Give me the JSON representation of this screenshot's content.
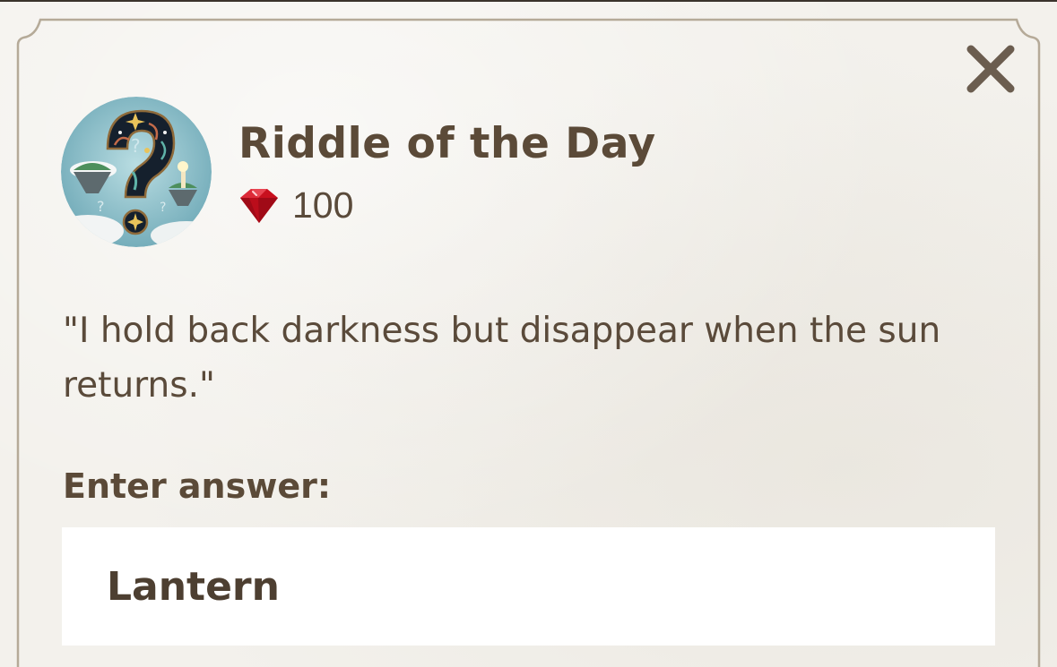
{
  "dialog": {
    "title": "Riddle of the Day",
    "avatar_icon": "riddle-question-mark-icon",
    "close_icon": "close-icon",
    "reward": {
      "icon": "ruby-gem-icon",
      "amount": "100"
    },
    "riddle": "\"I hold back darkness but disappear when the sun returns.\"",
    "answer_label": "Enter answer:",
    "answer_value": "Lantern"
  },
  "colors": {
    "background": "#f3f1ec",
    "frame_border": "#b5aa98",
    "text": "#5a4a3a",
    "close_icon": "#6b5d4f",
    "gem": "#c8101e",
    "input_background": "#ffffff",
    "avatar_background": "#8fbfc9"
  }
}
